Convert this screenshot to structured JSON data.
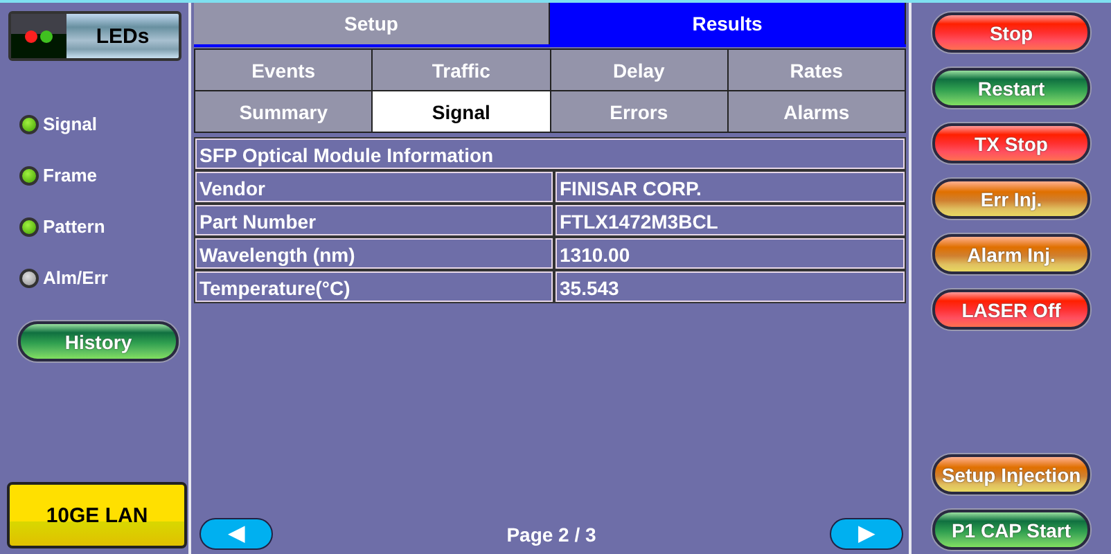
{
  "leds_button": {
    "label": "LEDs"
  },
  "leds": [
    {
      "label": "Signal",
      "on": true
    },
    {
      "label": "Frame",
      "on": true
    },
    {
      "label": "Pattern",
      "on": true
    },
    {
      "label": "Alm/Err",
      "on": false
    }
  ],
  "history_button": {
    "label": "History"
  },
  "mode_button": {
    "label": "10GE LAN"
  },
  "main_tabs": [
    {
      "label": "Setup",
      "selected": false
    },
    {
      "label": "Results",
      "selected": true
    }
  ],
  "sub_tabs": [
    {
      "label": "Events",
      "selected": false
    },
    {
      "label": "Traffic",
      "selected": false
    },
    {
      "label": "Delay",
      "selected": false
    },
    {
      "label": "Rates",
      "selected": false
    },
    {
      "label": "Summary",
      "selected": false
    },
    {
      "label": "Signal",
      "selected": true
    },
    {
      "label": "Errors",
      "selected": false
    },
    {
      "label": "Alarms",
      "selected": false
    }
  ],
  "table": {
    "title": "SFP Optical Module Information",
    "rows": [
      {
        "label": "Vendor",
        "value": "FINISAR CORP."
      },
      {
        "label": "Part Number",
        "value": "FTLX1472M3BCL"
      },
      {
        "label": "Wavelength (nm)",
        "value": "1310.00"
      },
      {
        "label": "Temperature(°C)",
        "value": "35.543"
      }
    ]
  },
  "pager": {
    "prev": "◀",
    "page": "Page 2 / 3",
    "next": "▶"
  },
  "actions": [
    {
      "label": "Stop",
      "kind": "red"
    },
    {
      "label": "Restart",
      "kind": "green"
    },
    {
      "label": "TX Stop",
      "kind": "red"
    },
    {
      "label": "Err Inj.",
      "kind": "orange"
    },
    {
      "label": "Alarm Inj.",
      "kind": "orange"
    },
    {
      "label": "LASER Off",
      "kind": "red"
    }
  ],
  "bottom_actions": [
    {
      "label": "Setup Injection",
      "kind": "orange"
    },
    {
      "label": "P1 CAP Start",
      "kind": "green"
    }
  ]
}
